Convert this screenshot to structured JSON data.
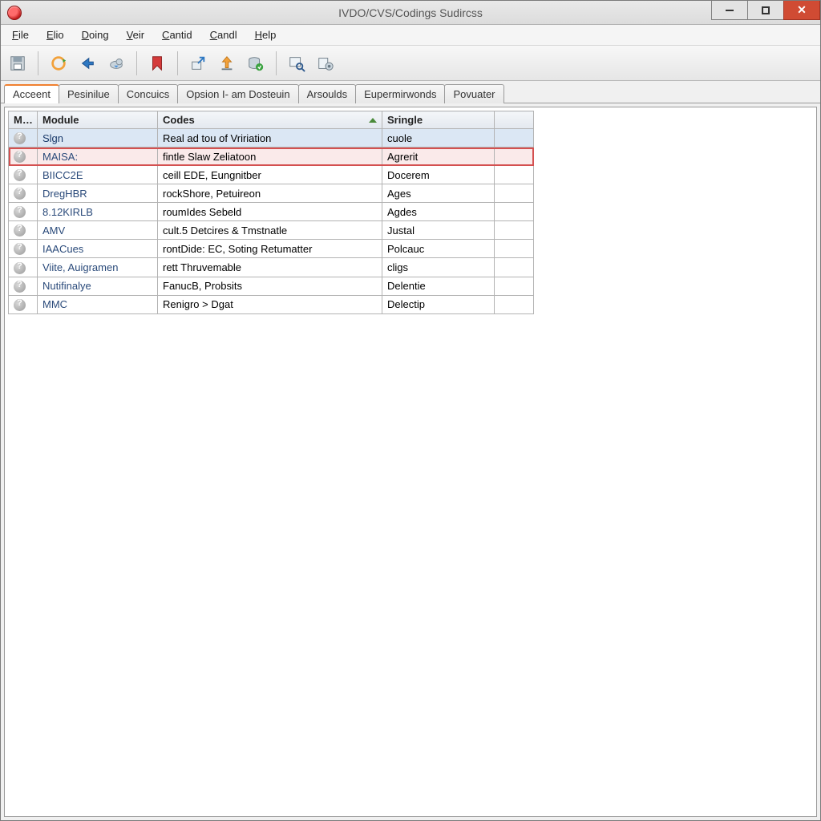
{
  "window": {
    "title": "IVDO/CVS/Codings Sudircss"
  },
  "menu": {
    "items": [
      "File",
      "Elio",
      "Doing",
      "Veir",
      "Cantid",
      "Candl",
      "Help"
    ]
  },
  "toolbar": {
    "buttons": [
      {
        "name": "save-icon"
      },
      {
        "sep": true
      },
      {
        "name": "refresh-icon"
      },
      {
        "name": "back-arrow-icon"
      },
      {
        "name": "cloud-sync-icon"
      },
      {
        "sep": true
      },
      {
        "name": "bookmark-icon"
      },
      {
        "sep": true
      },
      {
        "name": "export-icon"
      },
      {
        "name": "upload-icon"
      },
      {
        "name": "database-refresh-icon"
      },
      {
        "sep": true
      },
      {
        "name": "search-icon"
      },
      {
        "name": "settings-icon"
      }
    ]
  },
  "tabs": {
    "items": [
      "Acceent",
      "Pesinilue",
      "Concuics",
      "Opsion I- am Dosteuin",
      "Arsoulds",
      "Eupermirwonds",
      "Povuater"
    ],
    "active_index": 0
  },
  "table": {
    "columns": [
      "Miitle:",
      "Module",
      "Codes",
      "Sringle",
      ""
    ],
    "sorted_col": 2,
    "rows": [
      {
        "module": "Slgn",
        "codes": "Real ad tou of Vririation",
        "sringle": "cuole",
        "selected": true
      },
      {
        "module": "MAISA:",
        "codes": "fintle Slaw Zeliatoon",
        "sringle": "Agrerit",
        "highlight": true
      },
      {
        "module": "BIICC2E",
        "codes": "ceill EDE, Eungnitber",
        "sringle": "Docerem"
      },
      {
        "module": "DregHBR",
        "codes": "rockShore, Petuireon",
        "sringle": "Ages"
      },
      {
        "module": "8.12KIRLB",
        "codes": "roumIdes Sebeld",
        "sringle": "Agdes"
      },
      {
        "module": "AMV",
        "codes": "cult.5 Detcires & Tmstnatle",
        "sringle": "Justal"
      },
      {
        "module": "IAACues",
        "codes": "rontDide: EC, Soting Retumatter",
        "sringle": "Polcauc"
      },
      {
        "module": "Viite, Auigramen",
        "codes": "rett Thruvemable",
        "sringle": "cligs"
      },
      {
        "module": "Nutifinalye",
        "codes": "FanucB, Probsits",
        "sringle": "Delentie"
      },
      {
        "module": "MMC",
        "codes": "Renigro > Dgat",
        "sringle": "Delectip"
      }
    ]
  }
}
